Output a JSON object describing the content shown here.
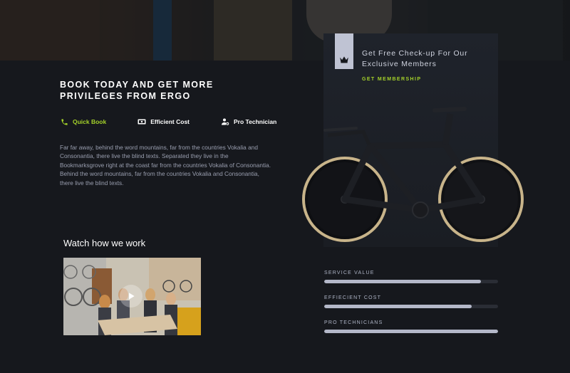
{
  "headline": "BOOK TODAY AND GET MORE PRIVILEGES FROM ERGO",
  "features": [
    {
      "label": "Quick Book",
      "icon": "phone-icon",
      "active": true
    },
    {
      "label": "Efficient Cost",
      "icon": "money-icon",
      "active": false
    },
    {
      "label": "Pro Technician",
      "icon": "technician-icon",
      "active": false
    }
  ],
  "paragraph": "Far far away, behind the word mountains, far from the countries Vokalia and Consonantia, there live the blind texts. Separated they live in the Bookmarksgrove right at the coast far from the countries Vokalia of Consonantia. Behind the word mountains, far from the countries Vokalia and Consonantia, there live the blind texts.",
  "video": {
    "title": "Watch how we work"
  },
  "membership": {
    "title": "Get Free Check-up For Our Exclusive Members",
    "link": "GET MEMBERSHIP",
    "icon": "crown-icon"
  },
  "stats": [
    {
      "label": "SERVICE VALUE",
      "value": 0.9
    },
    {
      "label": "EFFIECIENT COST",
      "value": 0.85
    },
    {
      "label": "PRO TECHNICIANS",
      "value": 1.0
    }
  ],
  "colors": {
    "accent": "#a4d12a",
    "background": "#16181d",
    "bar_fill": "#b4b8c9",
    "bar_track": "#2a2d35"
  }
}
